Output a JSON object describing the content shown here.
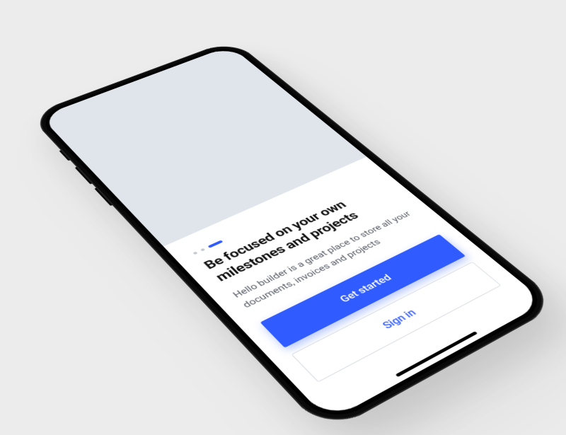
{
  "onboarding": {
    "pages_total": 3,
    "current_index": 2,
    "headline": "Be focused on your own milestones and projects",
    "subtext": "Hello builder is a great place to store all your documents, invoices and projects"
  },
  "actions": {
    "primary_label": "Get started",
    "secondary_label": "Sign in"
  },
  "colors": {
    "accent": "#2f5bff",
    "background": "#ececec"
  }
}
